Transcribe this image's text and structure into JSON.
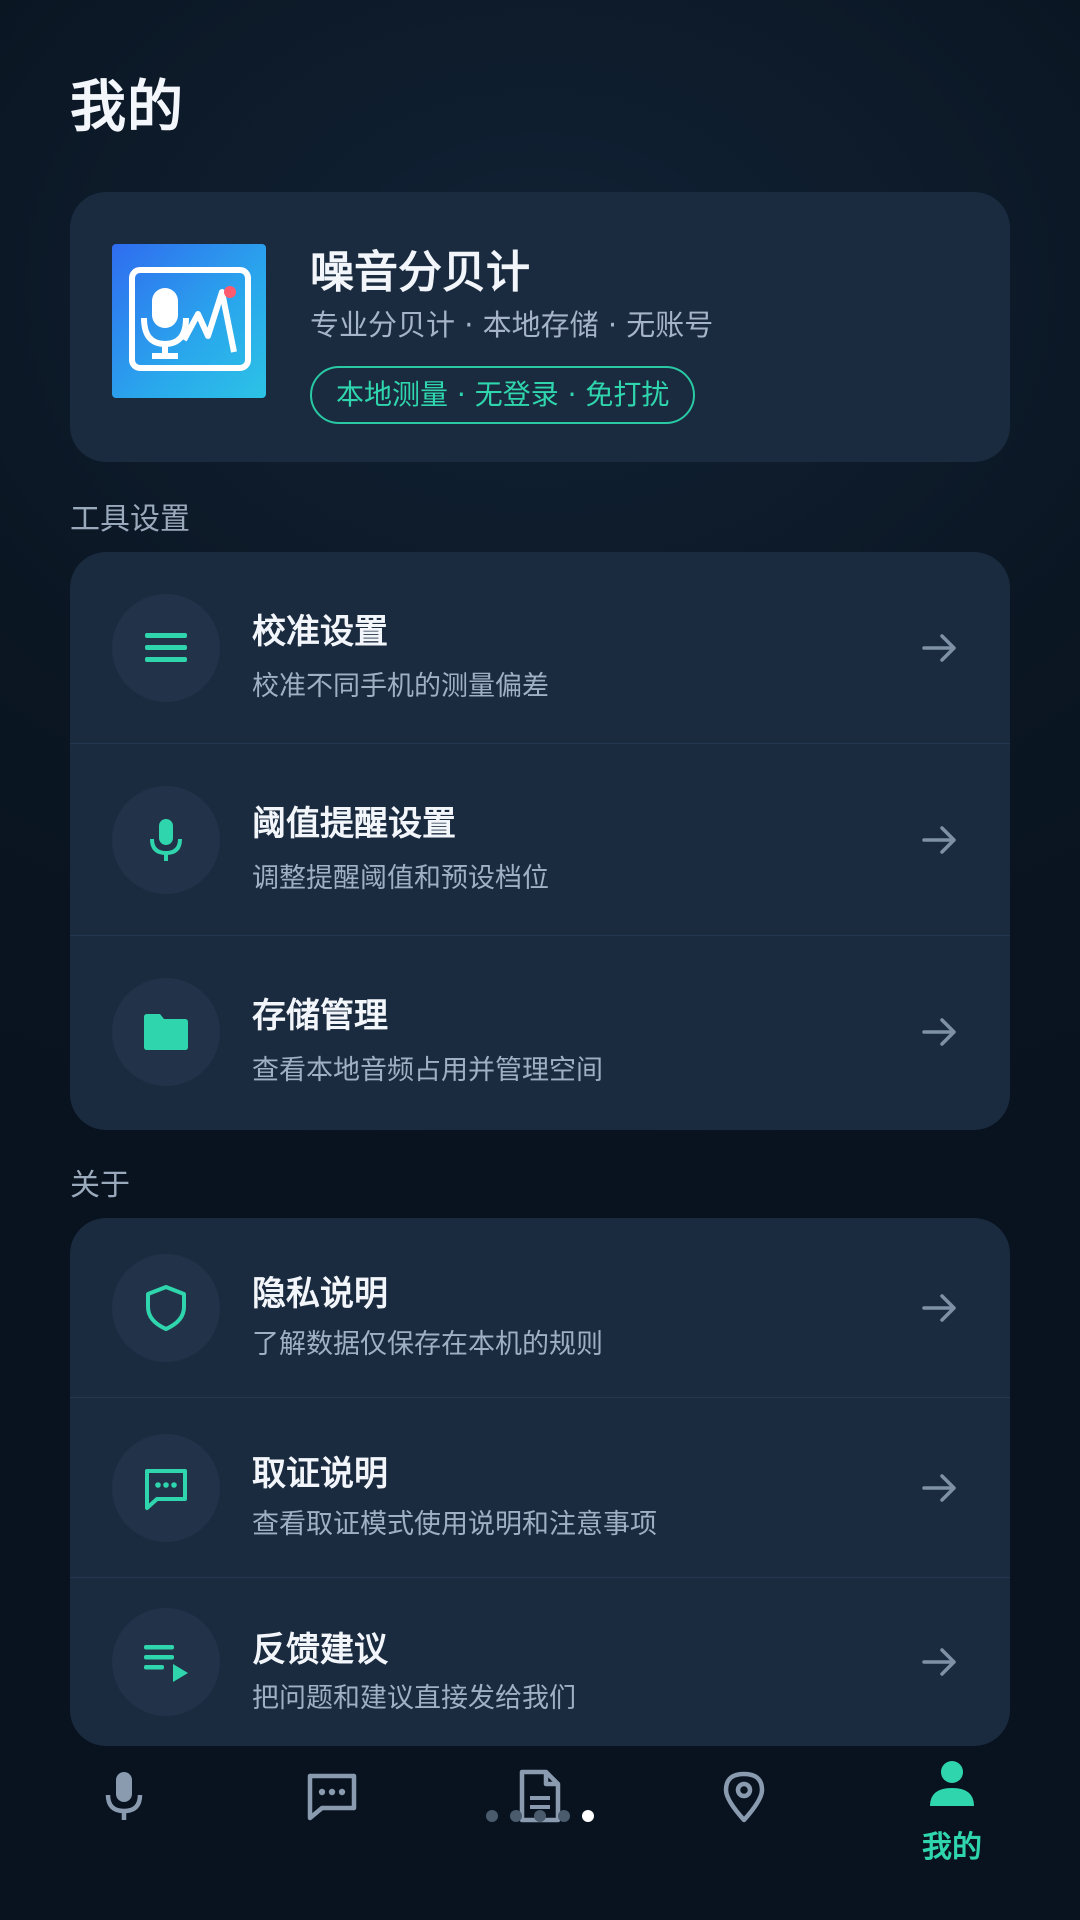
{
  "header": {
    "title": "我的"
  },
  "app_card": {
    "name": "噪音分贝计",
    "subtitle": "专业分贝计 · 本地存储 · 无账号",
    "badge": "本地测量 · 无登录 · 免打扰"
  },
  "sections": [
    {
      "label": "工具设置",
      "items": [
        {
          "title": "校准设置",
          "desc": "校准不同手机的测量偏差",
          "icon": "menu-lines-icon"
        },
        {
          "title": "阈值提醒设置",
          "desc": "调整提醒阈值和预设档位",
          "icon": "microphone-icon"
        },
        {
          "title": "存储管理",
          "desc": "查看本地音频占用并管理空间",
          "icon": "folder-icon"
        }
      ]
    },
    {
      "label": "关于",
      "items": [
        {
          "title": "隐私说明",
          "desc": "了解数据仅保存在本机的规则",
          "icon": "shield-icon"
        },
        {
          "title": "取证说明",
          "desc": "查看取证模式使用说明和注意事项",
          "icon": "chat-bubble-icon"
        },
        {
          "title": "反馈建议",
          "desc": "把问题和建议直接发给我们",
          "icon": "playlist-play-icon"
        }
      ]
    }
  ],
  "tabbar": {
    "tabs": [
      {
        "icon": "microphone-icon",
        "active": false
      },
      {
        "icon": "chat-bubble-icon",
        "active": false
      },
      {
        "icon": "document-icon",
        "active": false
      },
      {
        "icon": "location-pin-icon",
        "active": false
      },
      {
        "icon": "person-icon",
        "active": true,
        "label": "我的"
      }
    ]
  },
  "colors": {
    "accent": "#2fd6ad",
    "background": "#0b1623",
    "card": "#1a2a3f",
    "muted_text": "#9fb0c3"
  }
}
